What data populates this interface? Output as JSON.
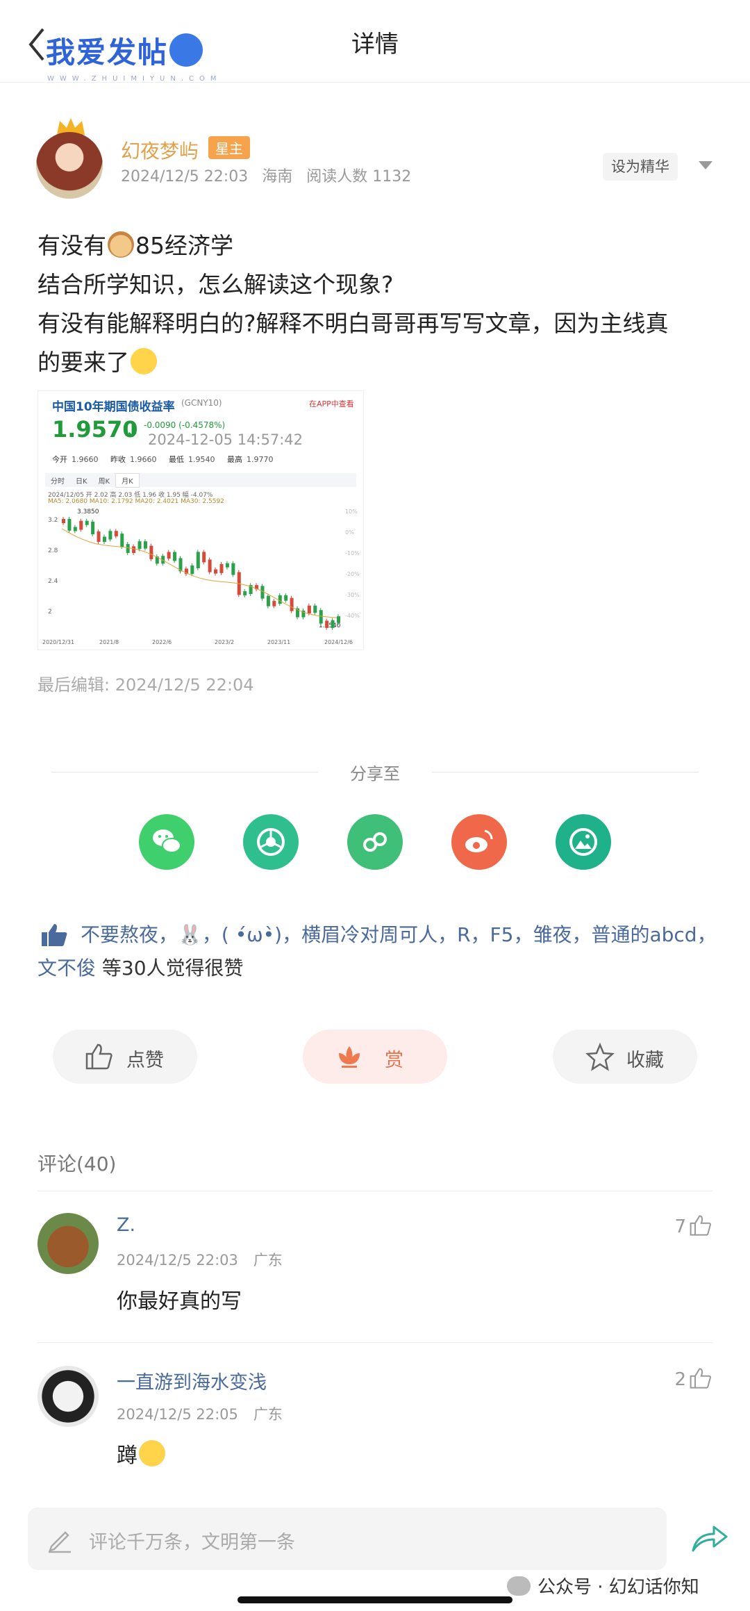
{
  "header": {
    "logo_text": "我爱发帖",
    "logo_sub": "WWW.ZHUIMIYUN.COM",
    "title": "详情"
  },
  "author": {
    "name": "幻夜梦屿",
    "badge": "星主",
    "time": "2024/12/5 22:03",
    "location": "海南",
    "reads": "阅读人数 1132",
    "featured_button": "设为精华"
  },
  "post": {
    "line1_a": "有没有",
    "line1_b": "85经济学",
    "line2": "结合所学知识，怎么解读这个现象?",
    "line3": "有没有能解释明白的?解释不明白哥哥再写写文章，因为主线真",
    "line4": "的要来了"
  },
  "stock_image": {
    "title": "中国10年期国债收益率",
    "code": "(GCNY10)",
    "app_link": "在APP中查看",
    "price": "1.9570",
    "change": "-0.0090 (-0.4578%)",
    "time": "2024-12-05 14:57:42",
    "ohlc": [
      {
        "label": "今开",
        "value": "1.9660"
      },
      {
        "label": "昨收",
        "value": "1.9660"
      },
      {
        "label": "最低",
        "value": "1.9540"
      },
      {
        "label": "最高",
        "value": "1.9770"
      }
    ],
    "tabs": [
      "分时",
      "日K",
      "周K",
      "月K"
    ],
    "info": "2024/12/05 开 2.02 高 2.03 低 1.96 收 1.95 幅 -4.07%",
    "ma": "MA5: 2.0680  MA10: 2.1792  MA20: 2.4021  MA30: 2.5592",
    "high_label": "3.3850",
    "low_label": "1.9540",
    "y_ticks": [
      "3.2",
      "2.8",
      "2.4",
      "2"
    ],
    "x_ticks": [
      "2020/12/31",
      "2021/8",
      "2022/6",
      "2023/2",
      "2023/11",
      "2024/12/6"
    ],
    "right_ticks": [
      "10%",
      "0%",
      "-10%",
      "-20%",
      "-30%",
      "-40%"
    ]
  },
  "last_edit": "最后编辑: 2024/12/5 22:04",
  "share": {
    "label": "分享至",
    "icons": [
      {
        "name": "wechat-icon",
        "color": "#3fcf6c"
      },
      {
        "name": "moments-icon",
        "color": "#2fbf8f"
      },
      {
        "name": "miniprogram-icon",
        "color": "#3fbf77"
      },
      {
        "name": "weibo-icon",
        "color": "#f0684a"
      },
      {
        "name": "album-icon",
        "color": "#1fb28a"
      }
    ]
  },
  "likes": {
    "names": "不要熬夜，🐰，( •́ω•̀)，横眉冷对周可人，R，F5，雏夜，普通的abcd，文不俊",
    "suffix": " 等30人觉得很赞"
  },
  "actions": {
    "like": "点赞",
    "reward": "赏",
    "favorite": "收藏"
  },
  "comments": {
    "title": "评论(40)",
    "items": [
      {
        "name": "Z.",
        "time": "2024/12/5 22:03",
        "location": "广东",
        "text": "你最好真的写",
        "likes": "7"
      },
      {
        "name": "一直游到海水变浅",
        "time": "2024/12/5 22:05",
        "location": "广东",
        "text": "蹲",
        "likes": "2"
      }
    ]
  },
  "bottom": {
    "placeholder": "评论千万条，文明第一条",
    "watermark": "公众号 · 幻幻话你知"
  }
}
